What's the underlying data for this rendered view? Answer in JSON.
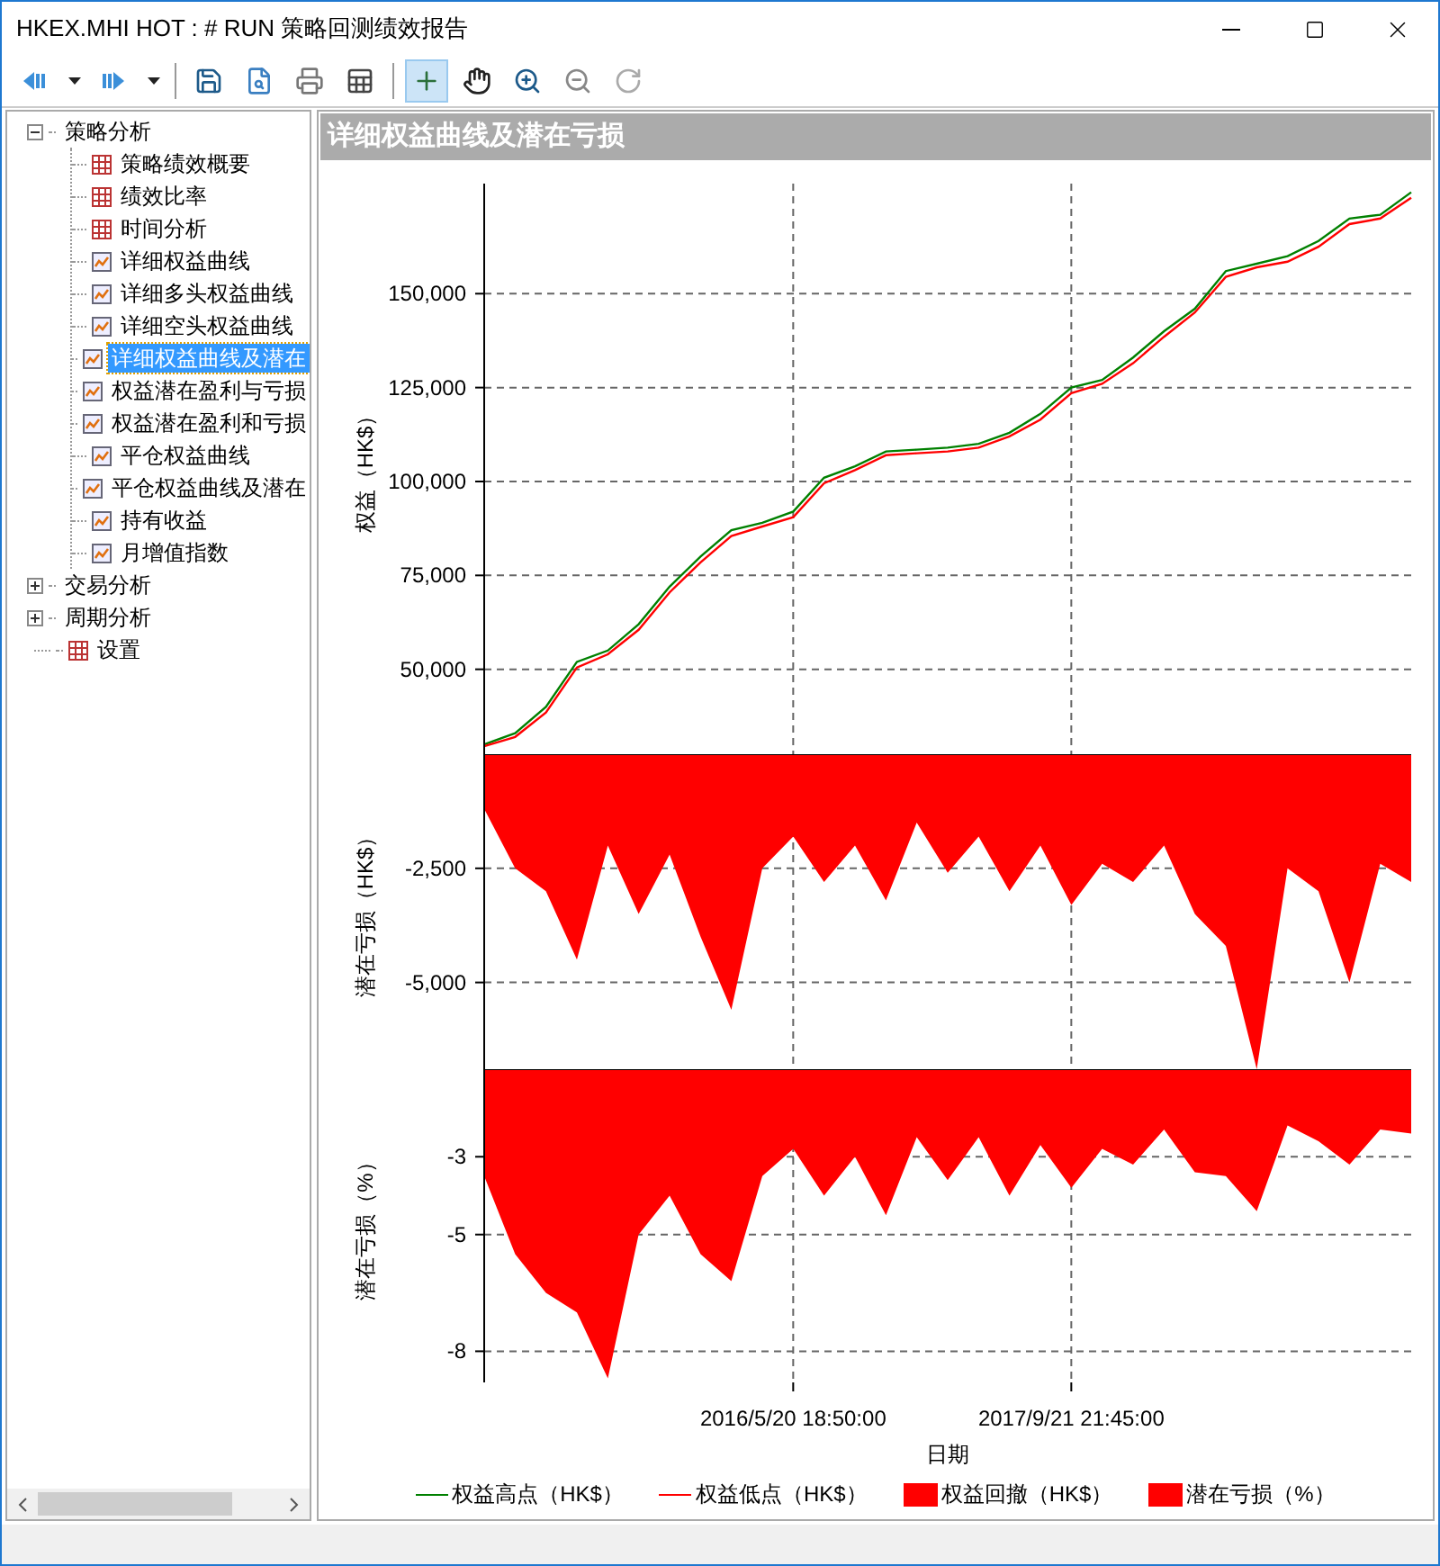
{
  "window": {
    "title": "HKEX.MHI HOT : # RUN 策略回测绩效报告"
  },
  "toolbar": {
    "groups": [
      [
        {
          "kind": "back",
          "pressed": false
        },
        {
          "kind": "caret",
          "pressed": false
        },
        {
          "kind": "forward",
          "pressed": false
        },
        {
          "kind": "caret",
          "pressed": false
        }
      ],
      [
        {
          "kind": "save",
          "pressed": false
        },
        {
          "kind": "preview",
          "pressed": false
        },
        {
          "kind": "print",
          "pressed": false
        },
        {
          "kind": "table",
          "pressed": false
        }
      ],
      [
        {
          "kind": "crosshair",
          "pressed": true
        },
        {
          "kind": "hand",
          "pressed": false
        },
        {
          "kind": "zoom-in",
          "pressed": false
        },
        {
          "kind": "zoom-out",
          "pressed": false
        },
        {
          "kind": "reset",
          "pressed": false
        }
      ]
    ]
  },
  "tree": [
    {
      "label": "策略分析",
      "expanded": true,
      "selected": false,
      "children": [
        {
          "label": "策略绩效概要",
          "kind": "table",
          "selected": false
        },
        {
          "label": "绩效比率",
          "kind": "table",
          "selected": false
        },
        {
          "label": "时间分析",
          "kind": "table",
          "selected": false
        },
        {
          "label": "详细权益曲线",
          "kind": "chart",
          "selected": false
        },
        {
          "label": "详细多头权益曲线",
          "kind": "chart",
          "selected": false
        },
        {
          "label": "详细空头权益曲线",
          "kind": "chart",
          "selected": false
        },
        {
          "label": "详细权益曲线及潜在",
          "kind": "chart",
          "selected": true
        },
        {
          "label": "权益潜在盈利与亏损",
          "kind": "chart",
          "selected": false
        },
        {
          "label": "权益潜在盈利和亏损",
          "kind": "chart",
          "selected": false
        },
        {
          "label": "平仓权益曲线",
          "kind": "chart",
          "selected": false
        },
        {
          "label": "平仓权益曲线及潜在",
          "kind": "chart",
          "selected": false
        },
        {
          "label": "持有收益",
          "kind": "chart",
          "selected": false
        },
        {
          "label": "月增值指数",
          "kind": "chart",
          "selected": false
        }
      ]
    },
    {
      "label": "交易分析",
      "expanded": false,
      "selected": false
    },
    {
      "label": "周期分析",
      "expanded": false,
      "selected": false
    },
    {
      "label": "设置",
      "kind": "table",
      "selected": false
    }
  ],
  "panel": {
    "title": "详细权益曲线及潜在亏损"
  },
  "charts": [
    {
      "chart_data": {
        "type": "line",
        "ylabel": "权益（HK$）",
        "grid": true,
        "ylim": [
          27400,
          179300
        ],
        "yticks": [
          {
            "value": 50000,
            "label": "50,000"
          },
          {
            "value": 75000,
            "label": "75,000"
          },
          {
            "value": 100000,
            "label": "100,000"
          },
          {
            "value": 125000,
            "label": "125,000"
          },
          {
            "value": 150000,
            "label": "150,000"
          }
        ],
        "series": [
          {
            "name": "权益高点（HK$）",
            "color": "#008000",
            "values": [
              30000,
              33000,
              40000,
              52000,
              55000,
              62000,
              72000,
              80000,
              87000,
              89000,
              92000,
              101000,
              104000,
              108000,
              108500,
              109000,
              110000,
              113000,
              118000,
              125000,
              127000,
              133000,
              140000,
              146000,
              156000,
              158000,
              160000,
              164000,
              170000,
              171000,
              177000
            ]
          },
          {
            "name": "权益低点（HK$）",
            "color": "#ff0000",
            "values": [
              29500,
              32000,
              38500,
              50500,
              54000,
              60500,
              70500,
              78500,
              85500,
              88000,
              90500,
              99500,
              103000,
              107000,
              107500,
              108000,
              109000,
              112000,
              116500,
              123500,
              126000,
              131500,
              138500,
              145000,
              154500,
              157000,
              158500,
              162500,
              168500,
              170000,
              175500
            ]
          }
        ]
      }
    },
    {
      "chart_data": {
        "type": "area",
        "ylabel": "潜在亏损（HK$）",
        "grid": true,
        "ylim": [
          -6900,
          0
        ],
        "yticks": [
          {
            "value": -2500,
            "label": "-2,500"
          },
          {
            "value": -5000,
            "label": "-5,000"
          }
        ],
        "series": [
          {
            "name": "权益回撤（HK$）",
            "color": "#ff0000",
            "values": [
              -1200,
              -2500,
              -3000,
              -4500,
              -2000,
              -3500,
              -2200,
              -4000,
              -5600,
              -2500,
              -1800,
              -2800,
              -2000,
              -3200,
              -1500,
              -2600,
              -1800,
              -3000,
              -2000,
              -3300,
              -2400,
              -2800,
              -2000,
              -3500,
              -4200,
              -6900,
              -2500,
              -3000,
              -5000,
              -2400,
              -2800
            ]
          }
        ]
      }
    },
    {
      "chart_data": {
        "type": "area",
        "xlabel": "日期",
        "ylabel": "潜在亏损（%）",
        "grid": true,
        "ylim": [
          -8.8,
          -0.75
        ],
        "categories": [
          null,
          null,
          null,
          null,
          null,
          null,
          null,
          null,
          null,
          null,
          "2016/5/20 18:50:00",
          null,
          null,
          null,
          null,
          null,
          null,
          null,
          null,
          "2017/9/21 21:45:00",
          null,
          null,
          null,
          null,
          null,
          null,
          null,
          null,
          null,
          null,
          null
        ],
        "yticks": [
          {
            "value": -3,
            "label": "-3"
          },
          {
            "value": -5,
            "label": "-5"
          },
          {
            "value": -8,
            "label": "-8"
          }
        ],
        "series": [
          {
            "name": "潜在亏损（%）",
            "color": "#ff0000",
            "values": [
              -3.5,
              -5.5,
              -6.5,
              -7,
              -8.7,
              -5,
              -4,
              -5.5,
              -6.2,
              -3.5,
              -2.8,
              -4,
              -3,
              -4.5,
              -2.5,
              -3.6,
              -2.5,
              -4,
              -2.7,
              -3.8,
              -2.8,
              -3.2,
              -2.3,
              -3.4,
              -3.5,
              -4.4,
              -2.2,
              -2.6,
              -3.2,
              -2.3,
              -2.4
            ]
          }
        ]
      }
    }
  ]
}
